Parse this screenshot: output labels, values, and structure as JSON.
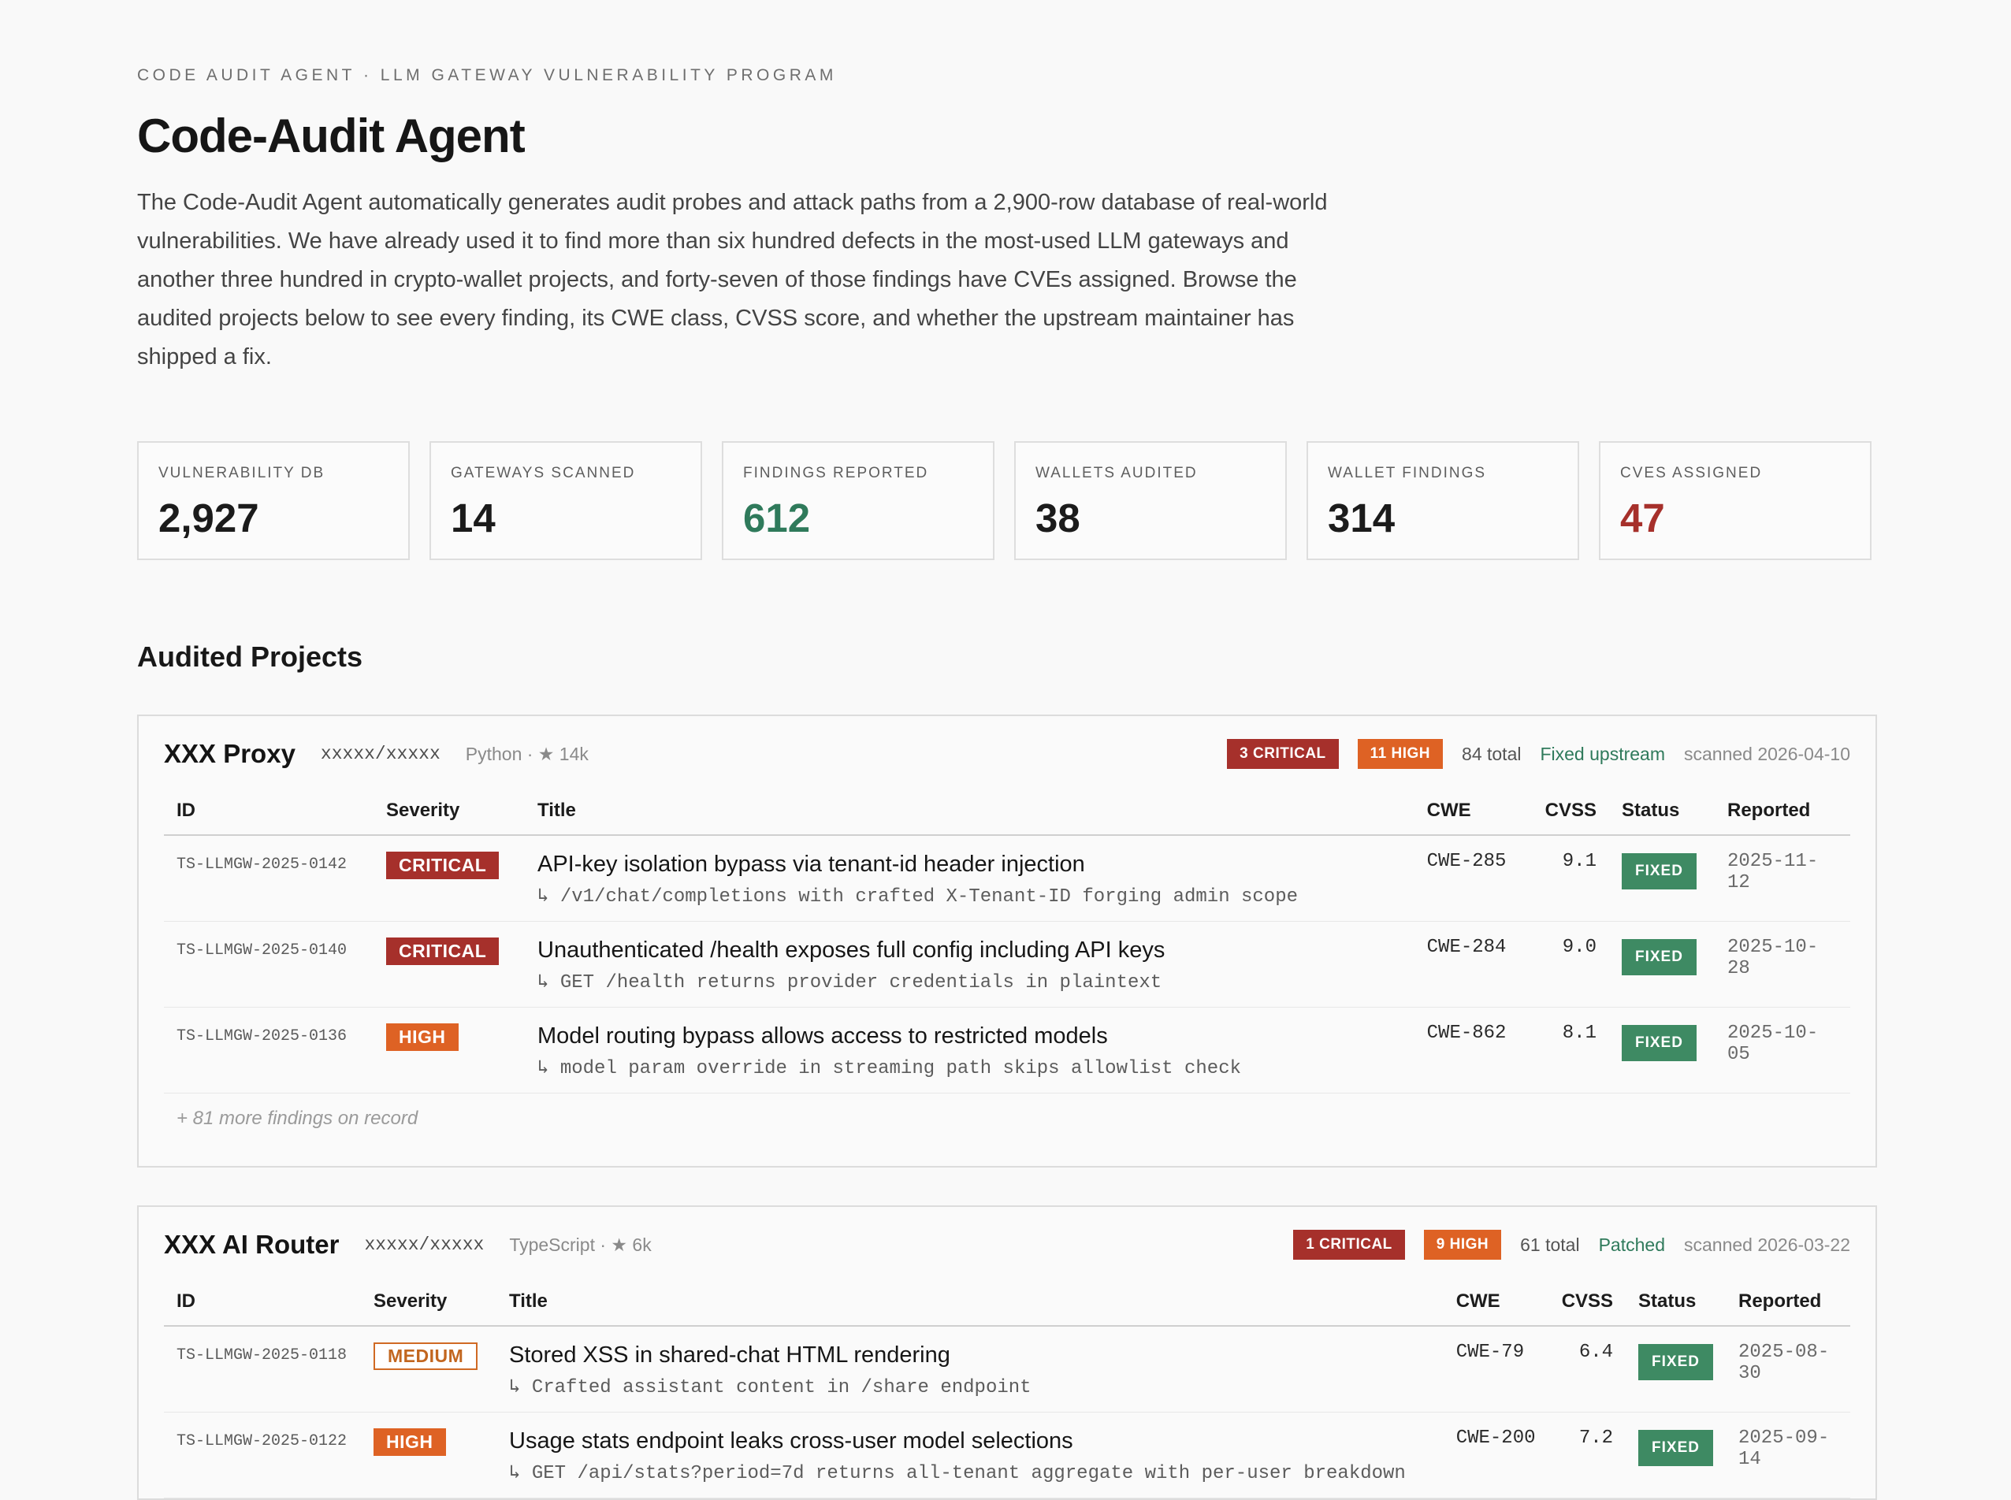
{
  "header": {
    "eyebrow": "CODE AUDIT AGENT · LLM GATEWAY VULNERABILITY PROGRAM",
    "title": "Code-Audit Agent",
    "intro": "The Code-Audit Agent automatically generates audit probes and attack paths from a 2,900-row database of real-world vulnerabilities. We have already used it to find more than six hundred defects in the most-used LLM gateways and another three hundred in crypto-wallet projects, and forty-seven of those findings have CVEs assigned. Browse the audited projects below to see every finding, its CWE class, CVSS score, and whether the upstream maintainer has shipped a fix."
  },
  "stats": [
    {
      "label": "VULNERABILITY DB",
      "value": "2,927"
    },
    {
      "label": "GATEWAYS SCANNED",
      "value": "14"
    },
    {
      "label": "FINDINGS REPORTED",
      "value": "612"
    },
    {
      "label": "WALLETS AUDITED",
      "value": "38"
    },
    {
      "label": "WALLET FINDINGS",
      "value": "314"
    },
    {
      "label": "CVES ASSIGNED",
      "value": "47"
    }
  ],
  "section_title": "Audited Projects",
  "columns": [
    "ID",
    "Severity",
    "Title",
    "CWE",
    "CVSS",
    "Status",
    "Reported"
  ],
  "projects": [
    {
      "name": "XXX Proxy",
      "repo": "xxxxx/xxxxx",
      "lang": "Python · ★ 14k",
      "critical_tag": "3 CRITICAL",
      "high_tag": "11 HIGH",
      "total": "84 total",
      "fix_state": "Fixed upstream",
      "scanned": "scanned 2026-04-10",
      "findings": [
        {
          "id": "TS-LLMGW-2025-0142",
          "severity": "CRITICAL",
          "title": "API-key isolation bypass via tenant-id header injection",
          "detail": "↳ /v1/chat/completions with crafted X-Tenant-ID forging admin scope",
          "cwe": "CWE-285",
          "cvss": "9.1",
          "status": "FIXED",
          "reported": "2025-11-12"
        },
        {
          "id": "TS-LLMGW-2025-0140",
          "severity": "CRITICAL",
          "title": "Unauthenticated /health exposes full config including API keys",
          "detail": "↳ GET /health returns provider credentials in plaintext",
          "cwe": "CWE-284",
          "cvss": "9.0",
          "status": "FIXED",
          "reported": "2025-10-28"
        },
        {
          "id": "TS-LLMGW-2025-0136",
          "severity": "HIGH",
          "title": "Model routing bypass allows access to restricted models",
          "detail": "↳ model param override in streaming path skips allowlist check",
          "cwe": "CWE-862",
          "cvss": "8.1",
          "status": "FIXED",
          "reported": "2025-10-05"
        }
      ],
      "more": "+ 81 more findings on record"
    },
    {
      "name": "XXX AI Router",
      "repo": "xxxxx/xxxxx",
      "lang": "TypeScript · ★ 6k",
      "critical_tag": "1 CRITICAL",
      "high_tag": "9 HIGH",
      "total": "61 total",
      "fix_state": "Patched",
      "scanned": "scanned 2026-03-22",
      "findings": [
        {
          "id": "TS-LLMGW-2025-0118",
          "severity": "MEDIUM",
          "title": "Stored XSS in shared-chat HTML rendering",
          "detail": "↳ Crafted assistant content in /share endpoint",
          "cwe": "CWE-79",
          "cvss": "6.4",
          "status": "FIXED",
          "reported": "2025-08-30"
        },
        {
          "id": "TS-LLMGW-2025-0122",
          "severity": "HIGH",
          "title": "Usage stats endpoint leaks cross-user model selections",
          "detail": "↳ GET /api/stats?period=7d returns all-tenant aggregate with per-user breakdown",
          "cwe": "CWE-200",
          "cvss": "7.2",
          "status": "FIXED",
          "reported": "2025-09-14"
        }
      ],
      "more": ""
    }
  ]
}
